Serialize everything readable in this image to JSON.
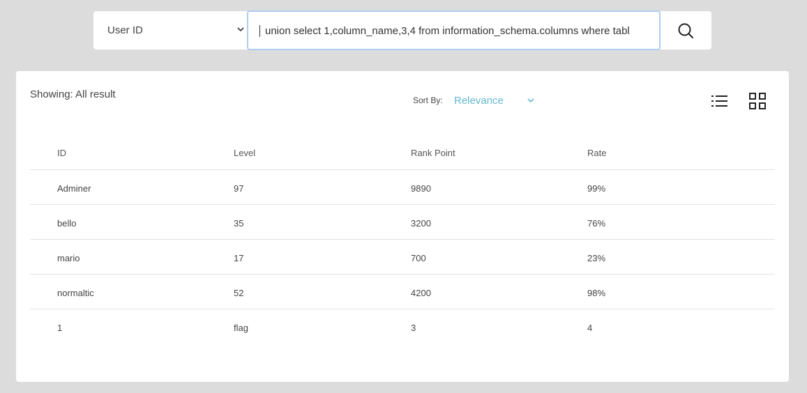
{
  "search": {
    "filter_label": "User ID",
    "query": "union select 1,column_name,3,4 from information_schema.columns where tabl"
  },
  "results": {
    "showing": "Showing: All result",
    "sort_label": "Sort By:",
    "sort_value": "Relevance"
  },
  "table": {
    "headers": [
      "ID",
      "Level",
      "Rank Point",
      "Rate"
    ],
    "rows": [
      [
        "Adminer",
        "97",
        "9890",
        "99%"
      ],
      [
        "bello",
        "35",
        "3200",
        "76%"
      ],
      [
        "mario",
        "17",
        "700",
        "23%"
      ],
      [
        "normaltic",
        "52",
        "4200",
        "98%"
      ],
      [
        "1",
        "flag",
        "3",
        "4"
      ]
    ]
  },
  "colors": {
    "accent": "#63b8d0",
    "input_focus": "#aecdf0",
    "background": "#dcdcdc"
  },
  "icons": {
    "search": "search-icon",
    "filter_chevron": "chevron-down-icon",
    "sort_chevron": "chevron-down-icon",
    "list_view": "list-view-icon",
    "grid_view": "grid-view-icon"
  }
}
